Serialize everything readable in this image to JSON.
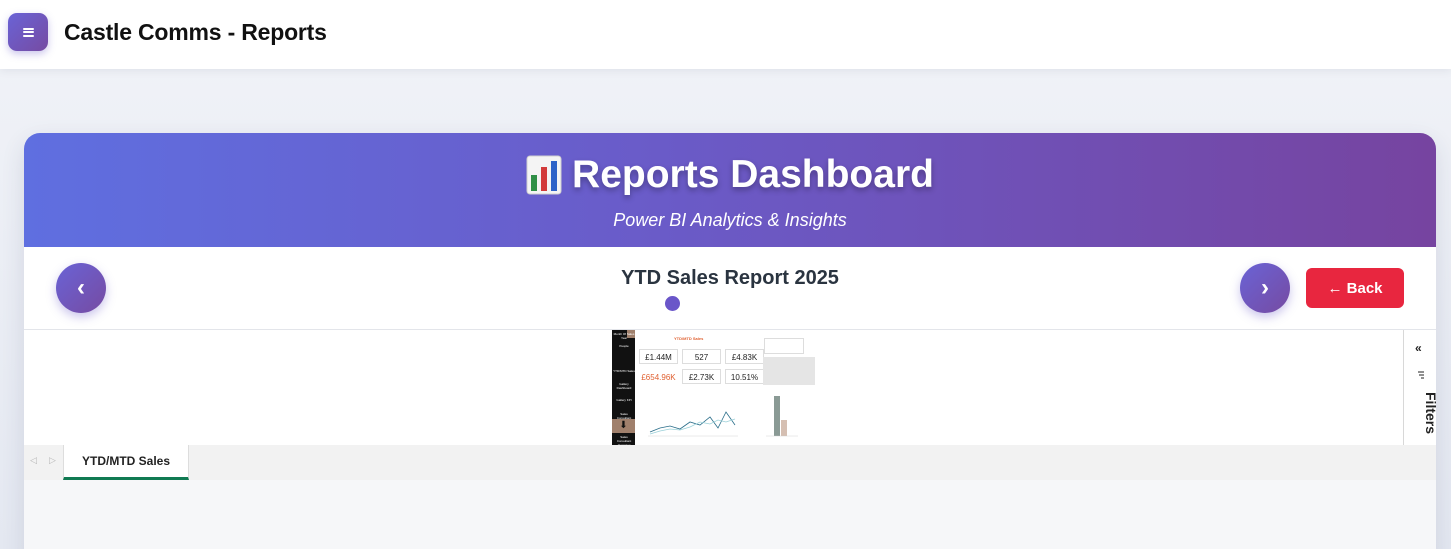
{
  "app": {
    "title": "Castle Comms - Reports"
  },
  "hero": {
    "title": "Reports Dashboard",
    "subtitle": "Power BI Analytics & Insights"
  },
  "navigation": {
    "prev_label": "‹",
    "next_label": "›",
    "report_title": "YTD Sales Report 2025",
    "back_label": "← Back"
  },
  "report_preview": {
    "heading": "YTD/MTD Sales",
    "sidebar_items": [
      "Month Of Sales Year",
      "People",
      "YTD/MTD Sales",
      "Gallery Dashboard",
      "Gallery KPI",
      "Sales Consultant",
      "Sales Consultant Overview"
    ],
    "kpis": [
      "£1.44M",
      "527",
      "£4.83K",
      "£654.96K",
      "£2.73K",
      "10.51%"
    ]
  },
  "filters_pane": {
    "collapse_label": "«",
    "label": "Filters"
  },
  "tabs": [
    {
      "label": "YTD/MTD Sales",
      "active": true
    }
  ],
  "tab_nav": {
    "prev": "◁",
    "next": "▷"
  },
  "colors": {
    "accent_start": "#667eea",
    "accent_end": "#764ba2",
    "back_button": "#e8263f",
    "active_tab_underline": "#107a52"
  },
  "icons": {
    "menu": "hamburger-icon",
    "hero": "bar-chart-icon",
    "filters": "filter-icon"
  }
}
